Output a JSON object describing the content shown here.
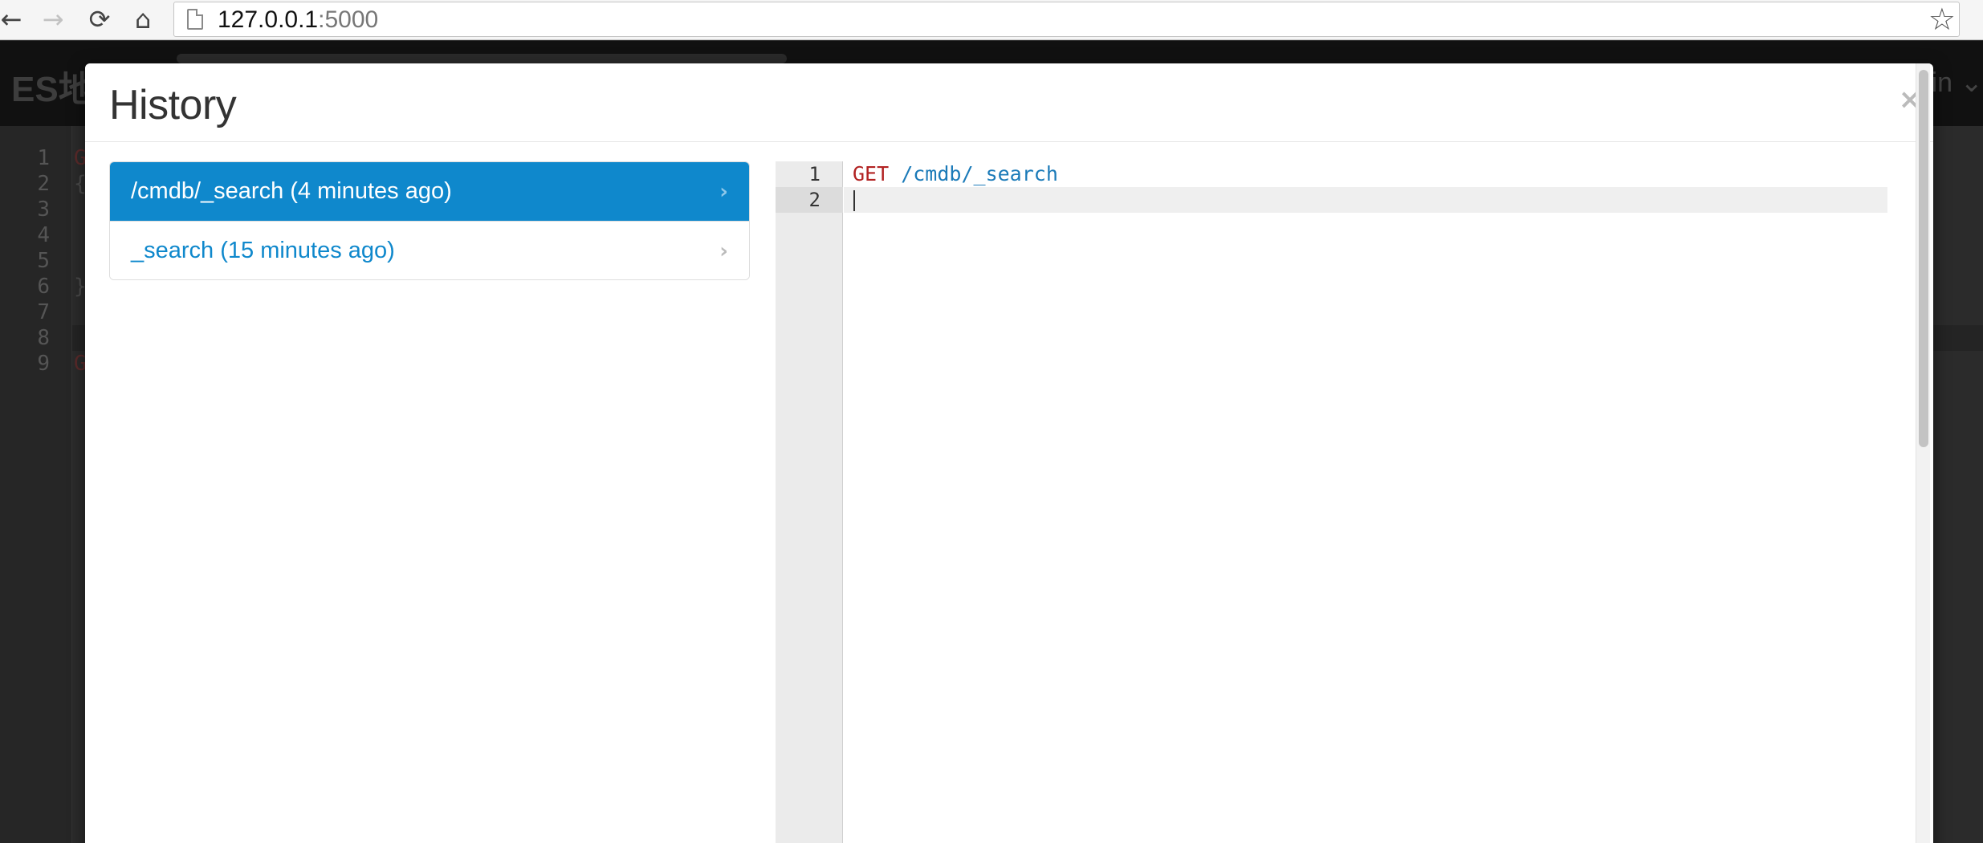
{
  "browser": {
    "back_icon": "←",
    "forward_icon": "→",
    "reload_icon": "⟳",
    "home_icon": "⌂",
    "url_host": "127.0.0.1",
    "url_port": ":5000",
    "bookmark_icon": "☆"
  },
  "app": {
    "brand": "ES地",
    "user_menu": "in ⌄",
    "editor_lines": [
      "1",
      "2",
      "3",
      "4",
      "5",
      "6",
      "7",
      "8",
      "9"
    ],
    "code_fragments": {
      "line1": "G",
      "line2": "{",
      "line6": "}",
      "line9": "G"
    }
  },
  "modal": {
    "title": "History",
    "close_label": "×",
    "history_items": [
      {
        "label": "/cmdb/_search (4 minutes ago)",
        "active": true
      },
      {
        "label": "_search (15 minutes ago)",
        "active": false
      }
    ],
    "chevron": "›",
    "preview": {
      "line_numbers": [
        "1",
        "2"
      ],
      "method": "GET",
      "path": " /cmdb/_search"
    }
  },
  "colors": {
    "accent": "#0f88cc",
    "method": "#b22222",
    "url": "#1a7ab8"
  }
}
